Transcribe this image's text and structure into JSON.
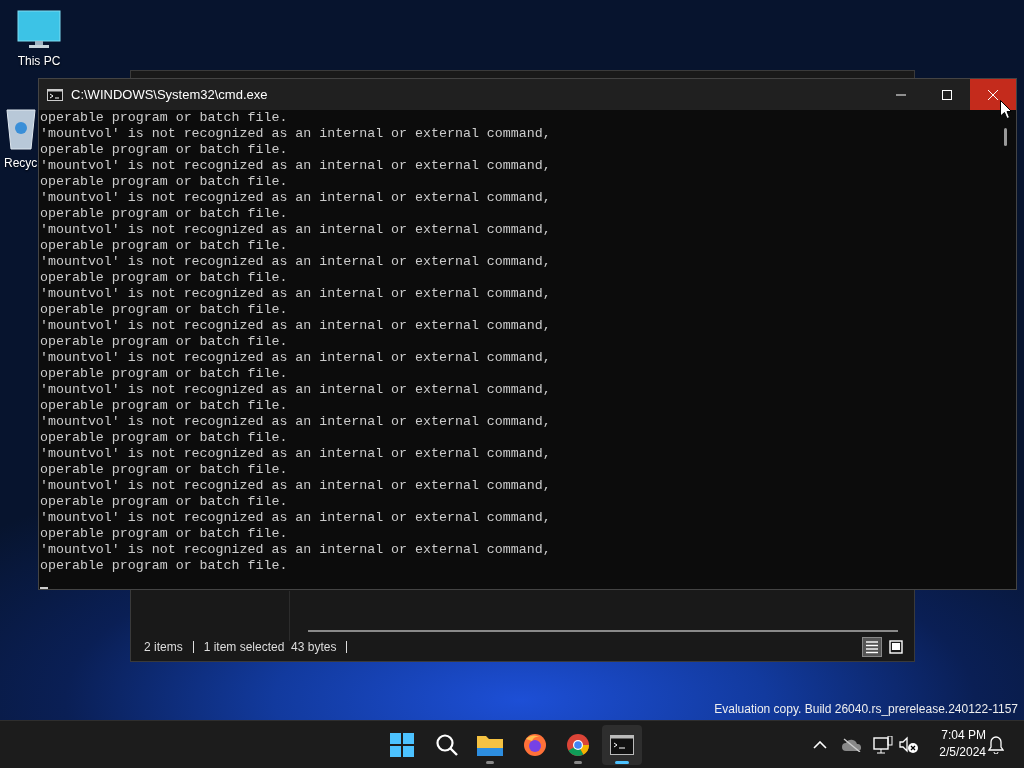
{
  "desktop_icons": [
    {
      "kind": "computer",
      "label": "This PC"
    },
    {
      "kind": "recycle-bin",
      "label": "Recyc"
    }
  ],
  "explorer": {
    "status_items": [
      "2 items",
      "1 item selected  43 bytes"
    ],
    "views": [
      {
        "kind": "details",
        "selected": true
      },
      {
        "kind": "preview",
        "selected": false
      }
    ]
  },
  "console": {
    "title": "C:\\WINDOWS\\System32\\cmd.exe",
    "close_hovered": true,
    "lines": [
      "operable program or batch file.",
      "'mountvol' is not recognized as an internal or external command,",
      "operable program or batch file.",
      "'mountvol' is not recognized as an internal or external command,",
      "operable program or batch file.",
      "'mountvol' is not recognized as an internal or external command,",
      "operable program or batch file.",
      "'mountvol' is not recognized as an internal or external command,",
      "operable program or batch file.",
      "'mountvol' is not recognized as an internal or external command,",
      "operable program or batch file.",
      "'mountvol' is not recognized as an internal or external command,",
      "operable program or batch file.",
      "'mountvol' is not recognized as an internal or external command,",
      "operable program or batch file.",
      "'mountvol' is not recognized as an internal or external command,",
      "operable program or batch file.",
      "'mountvol' is not recognized as an internal or external command,",
      "operable program or batch file.",
      "'mountvol' is not recognized as an internal or external command,",
      "operable program or batch file.",
      "'mountvol' is not recognized as an internal or external command,",
      "operable program or batch file.",
      "'mountvol' is not recognized as an internal or external command,",
      "operable program or batch file.",
      "'mountvol' is not recognized as an internal or external command,",
      "operable program or batch file.",
      "'mountvol' is not recognized as an internal or external command,",
      "operable program or batch file."
    ]
  },
  "watermark_text": "Evaluation copy. Build 26040.rs_prerelease.240122-1157",
  "taskbar": {
    "apps": [
      {
        "kind": "start",
        "running": false,
        "selected": false
      },
      {
        "kind": "search",
        "running": false,
        "selected": false
      },
      {
        "kind": "files",
        "running": true,
        "selected": false
      },
      {
        "kind": "firefox",
        "running": false,
        "selected": false
      },
      {
        "kind": "chrome",
        "running": true,
        "selected": false
      },
      {
        "kind": "terminal",
        "running": true,
        "selected": true
      }
    ],
    "time": "7:04 PM",
    "date": "2/5/2024"
  }
}
